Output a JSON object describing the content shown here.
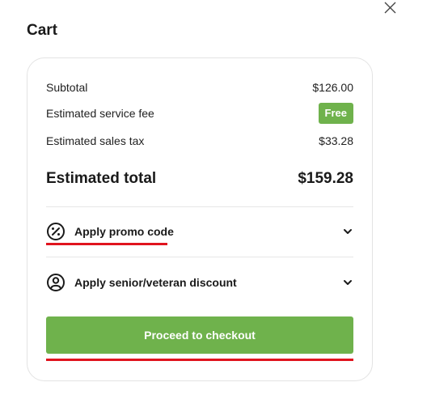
{
  "cart": {
    "title": "Cart",
    "close_icon": "close-icon"
  },
  "summary": {
    "subtotal_label": "Subtotal",
    "subtotal_value": "$126.00",
    "service_fee_label": "Estimated service fee",
    "service_fee_value": "Free",
    "sales_tax_label": "Estimated sales tax",
    "sales_tax_value": "$33.28",
    "total_label": "Estimated total",
    "total_value": "$159.28"
  },
  "options": {
    "promo": {
      "label": "Apply promo code",
      "icon": "percent-badge-icon"
    },
    "senior": {
      "label": "Apply senior/veteran discount",
      "icon": "user-circle-icon"
    }
  },
  "checkout": {
    "label": "Proceed to checkout"
  },
  "colors": {
    "accent_green": "#6fb24c",
    "highlight_red": "#e0141e",
    "border": "#e3e3e3"
  }
}
